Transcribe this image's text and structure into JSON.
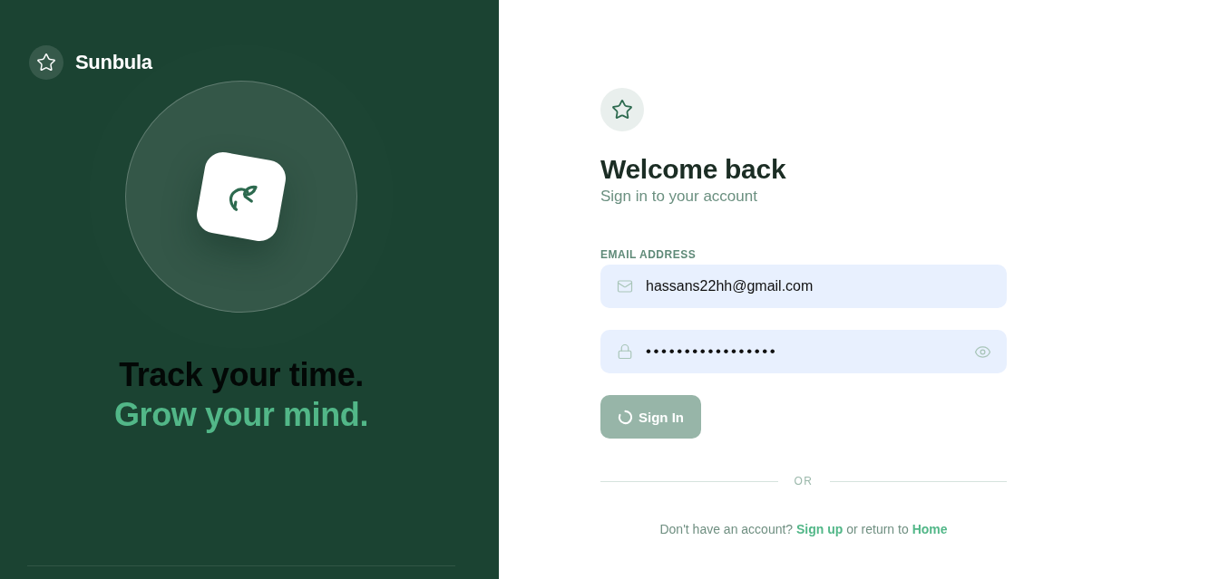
{
  "brand": {
    "name": "Sunbula"
  },
  "hero": {
    "title": "Track your time.",
    "accent": "Grow your mind."
  },
  "form": {
    "title": "Welcome back",
    "subtitle": "Sign in to your account",
    "fields": [
      {
        "kind": "email",
        "label": "EMAIL ADDRESS",
        "value": "hassans22hh@gmail.com"
      },
      {
        "kind": "password",
        "value": "•••••••••••••••••"
      }
    ],
    "submit": {
      "label": "Sign In",
      "loading": true
    },
    "divider": "OR",
    "footer": {
      "prompt": "Don't have an account?",
      "signup_link": "Sign up",
      "middle": "or return to",
      "home_link": "Home"
    }
  }
}
